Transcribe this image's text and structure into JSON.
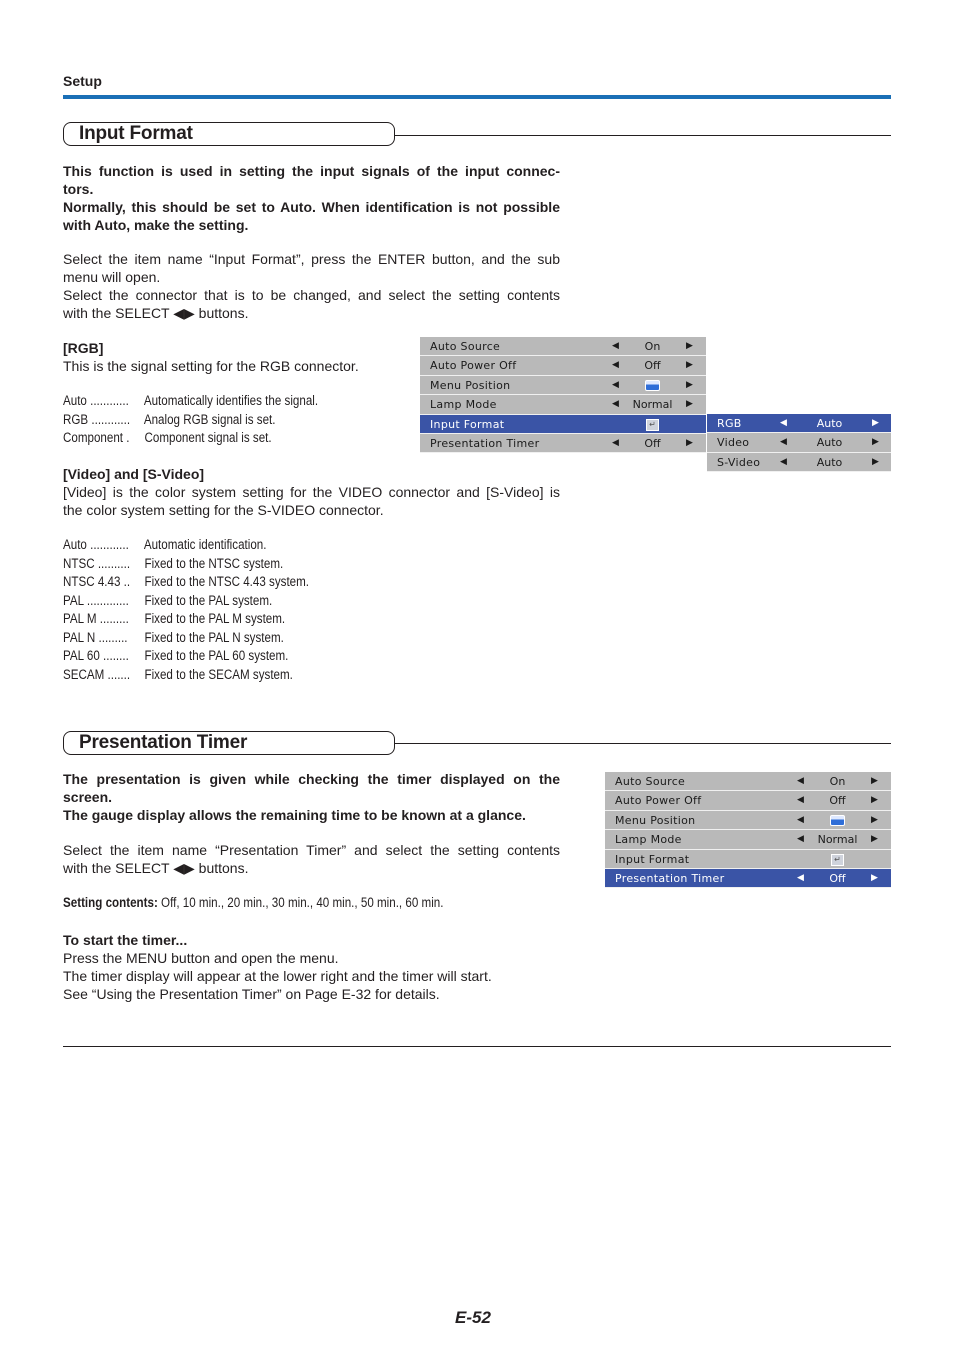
{
  "header": {
    "section": "Setup",
    "accent_color": "#1a6fb6"
  },
  "input_format": {
    "title": "Input Format",
    "intro_bold": [
      "This function is used in setting the input signals of the input connec-",
      "tors.",
      "Normally, this should be set to Auto. When identification is not possible",
      "with Auto, make the setting."
    ],
    "instructions": [
      "Select the item name “Input Format”, press the ENTER button, and the sub",
      "menu will open.",
      "Select the connector that is to be changed, and select the setting contents",
      "with the SELECT ◀▶ buttons."
    ],
    "rgb": {
      "heading": "[RGB]",
      "text": "This is the signal setting for the RGB connector.",
      "options": [
        {
          "key": "Auto ............",
          "desc": "Automatically identifies the signal."
        },
        {
          "key": "RGB ............",
          "desc": "Analog RGB signal is set."
        },
        {
          "key": "Component .",
          "desc": "Component signal is set."
        }
      ]
    },
    "video": {
      "heading": "[Video] and [S-Video]",
      "text": [
        "[Video] is the color system setting for the VIDEO connector and [S-Video] is",
        "the color system setting for the S-VIDEO connector."
      ],
      "options": [
        {
          "key": "Auto ............",
          "desc": "Automatic identification."
        },
        {
          "key": "NTSC ..........",
          "desc": "Fixed to the NTSC system."
        },
        {
          "key": "NTSC 4.43 ..",
          "desc": "Fixed to the NTSC 4.43 system."
        },
        {
          "key": "PAL .............",
          "desc": "Fixed to the PAL system."
        },
        {
          "key": "PAL M .........",
          "desc": "Fixed to the PAL M system."
        },
        {
          "key": "PAL N .........",
          "desc": "Fixed to the PAL N system."
        },
        {
          "key": "PAL 60 ........",
          "desc": "Fixed to the PAL 60 system."
        },
        {
          "key": "SECAM .......",
          "desc": "Fixed to the SECAM system."
        }
      ]
    },
    "menu": {
      "rows": [
        {
          "label": "Auto Source",
          "value": "On"
        },
        {
          "label": "Auto Power Off",
          "value": "Off"
        },
        {
          "label": "Menu Position",
          "value": "",
          "icon": "menu-position-icon"
        },
        {
          "label": "Lamp Mode",
          "value": "Normal"
        },
        {
          "label": "Input Format",
          "value": "↵",
          "icon": "enter-icon",
          "selected": true
        },
        {
          "label": "Presentation Timer",
          "value": "Off"
        }
      ],
      "submenu": [
        {
          "label": "RGB",
          "value": "Auto",
          "selected": true
        },
        {
          "label": "Video",
          "value": "Auto"
        },
        {
          "label": "S-Video",
          "value": "Auto"
        }
      ],
      "left_arrow": "◀",
      "right_arrow": "▶",
      "selected_color": "#3a54a6",
      "background_color": "#b9b9b9"
    }
  },
  "presentation_timer": {
    "title": "Presentation Timer",
    "intro_bold": [
      "The presentation is given while checking the timer displayed on the",
      "screen.",
      "The gauge display allows the remaining time to be known at a glance."
    ],
    "instructions": [
      "Select the item name “Presentation Timer” and select the setting contents",
      "with the SELECT ◀▶ buttons."
    ],
    "setting_label": "Setting contents:",
    "setting_values": " Off, 10 min., 20 min., 30 min., 40 min., 50 min., 60 min.",
    "start_heading": "To start the timer...",
    "start_text": [
      "Press the MENU button and open the menu.",
      "The timer display will appear at the lower right and the timer will start.",
      "See “Using the Presentation Timer” on Page E-32 for details."
    ],
    "menu": {
      "rows": [
        {
          "label": "Auto Source",
          "value": "On"
        },
        {
          "label": "Auto Power Off",
          "value": "Off"
        },
        {
          "label": "Menu Position",
          "value": "",
          "icon": "menu-position-icon"
        },
        {
          "label": "Lamp Mode",
          "value": "Normal"
        },
        {
          "label": "Input Format",
          "value": "↵",
          "icon": "enter-icon"
        },
        {
          "label": "Presentation Timer",
          "value": "Off",
          "selected": true
        }
      ]
    }
  },
  "footer": {
    "page_number": "E-52"
  }
}
